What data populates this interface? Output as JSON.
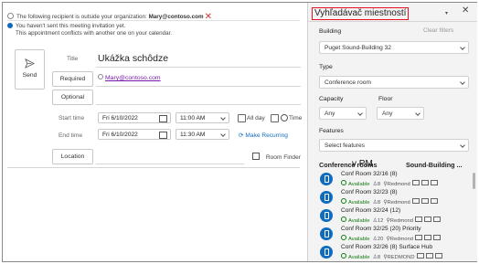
{
  "alerts": {
    "outside_org_prefix": "The following recipient is outside your organization:",
    "outside_org_email": "Mary@contoso.com",
    "not_sent": "You haven't sent this meeting invitation yet.",
    "conflict": "This appointment conflicts with another one on your calendar."
  },
  "compose": {
    "send_label": "Send",
    "title_label": "Title",
    "title_value": "Ukážka schôdze",
    "required_label": "Required",
    "required_value": "Mary@contoso.com",
    "optional_label": "Optional",
    "start_label": "Start time",
    "start_date": "Fri 6/10/2022",
    "start_time": "11:00 AM",
    "all_day_label": "All day",
    "time_zones_label": "Time",
    "end_label": "End time",
    "end_date": "Fri 6/10/2022",
    "end_time": "11:30 AM",
    "make_recurring_label": "Make Recurring",
    "location_label": "Location",
    "room_finder_label": "Room Finder"
  },
  "room_finder": {
    "title": "Vyhľadávač miestností",
    "building_label": "Building",
    "clear_filters_label": "Clear filters",
    "building_value": "Puget Sound-Building 32",
    "type_label": "Type",
    "type_value": "Conference room",
    "capacity_label": "Capacity",
    "capacity_value": "Any",
    "floor_label": "Floor",
    "floor_value": "Any",
    "features_label": "Features",
    "features_value": "Select features",
    "rooms_heading": "Conference rooms",
    "rooms_heading_pm": "v PM",
    "rooms_heading_building": "Sound-Building ...",
    "rooms": [
      {
        "name": "Conf Room 32/16 (8)",
        "status": "Available",
        "capacity": "8",
        "location": "Redmond"
      },
      {
        "name": "Conf Room 32/23 (8)",
        "status": "Available",
        "capacity": "8",
        "location": "Redmond"
      },
      {
        "name": "Conf Room 32/24 (12)",
        "status": "Available",
        "capacity": "12",
        "location": "Redmond"
      },
      {
        "name": "Conf Room 32/25 (20) Priority",
        "status": "Available",
        "capacity": "20",
        "location": "Redmond"
      },
      {
        "name": "Conf Room 32/26 (8) Surface Hub",
        "status": "Available",
        "capacity": "8",
        "location": "REDMOND"
      }
    ]
  },
  "colors": {
    "accent": "#0f6cbd",
    "available": "#107c10",
    "highlight_border": "#e81123",
    "link_purple": "#7719aa"
  }
}
